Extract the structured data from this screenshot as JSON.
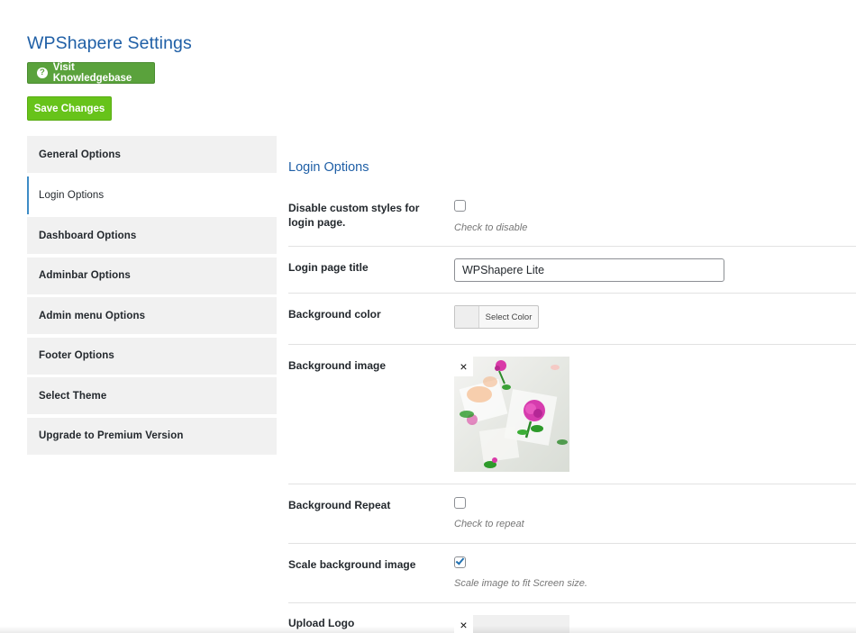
{
  "header": {
    "title": "WPShapere Settings",
    "knowledgebase_label": "Visit Knowledgebase",
    "help_glyph": "?",
    "save_label": "Save Changes"
  },
  "sidebar": {
    "items": [
      {
        "label": "General Options",
        "active": false
      },
      {
        "label": "Login Options",
        "active": true
      },
      {
        "label": "Dashboard Options",
        "active": false
      },
      {
        "label": "Adminbar Options",
        "active": false
      },
      {
        "label": "Admin menu Options",
        "active": false
      },
      {
        "label": "Footer Options",
        "active": false
      },
      {
        "label": "Select Theme",
        "active": false
      },
      {
        "label": "Upgrade to Premium Version",
        "active": false
      }
    ]
  },
  "main": {
    "section_title": "Login Options",
    "disable_styles": {
      "label": "Disable custom styles for login page.",
      "checked": false,
      "hint": "Check to disable"
    },
    "login_title": {
      "label": "Login page title",
      "value": "WPShapere Lite"
    },
    "background_color": {
      "label": "Background color",
      "button_label": "Select Color",
      "swatch_color": "#eeeeee"
    },
    "background_image": {
      "label": "Background image",
      "remove_glyph": "×"
    },
    "background_repeat": {
      "label": "Background Repeat",
      "checked": false,
      "hint": "Check to repeat"
    },
    "scale_background": {
      "label": "Scale background image",
      "checked": true,
      "hint": "Scale image to fit Screen size."
    },
    "upload_logo": {
      "label": "Upload Logo",
      "remove_glyph": "×"
    }
  },
  "colors": {
    "accent_blue": "#1f5fa6",
    "knowledgebase_green": "#5aa23c",
    "save_green": "#67c31a",
    "sidebar_bg": "#f1f1f1"
  }
}
